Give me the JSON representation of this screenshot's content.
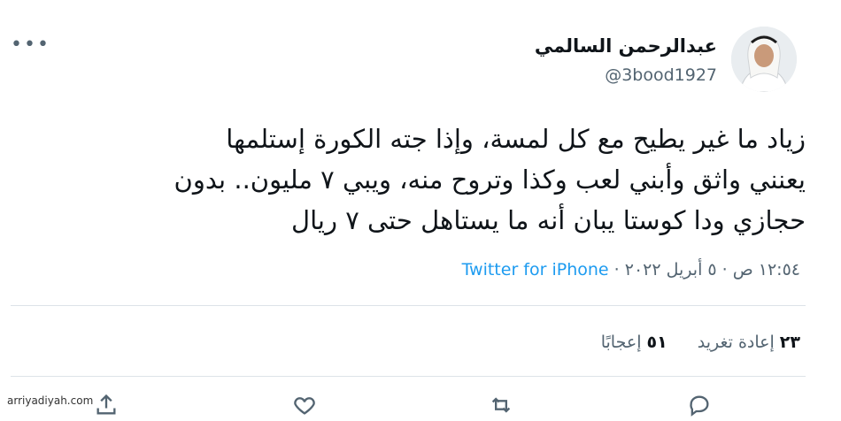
{
  "user": {
    "display_name": "عبدالرحمن السالمي",
    "handle": "@3bood1927"
  },
  "tweet": {
    "lines": [
      "زياد ما غير يطيح مع كل لمسة، وإذا جته الكورة إستلمها",
      "يعنني واثق وأبني لعب وكذا وتروح منه، ويبي ٧ مليون.. بدون",
      "حجازي ودا كوستا يبان أنه ما يستاهل حتى ٧ ريال"
    ],
    "time": "١٢:٥٤ ص",
    "date": "٥ أبريل ٢٠٢٢",
    "separator": "·",
    "source": "Twitter for iPhone"
  },
  "stats": {
    "retweets_count": "٢٣",
    "retweets_label": "إعادة تغريد",
    "likes_count": "٥١",
    "likes_label": "إعجابًا"
  },
  "icons": {
    "more": "more-horizontal-icon",
    "reply": "reply-icon",
    "retweet": "retweet-icon",
    "like": "heart-icon",
    "share": "share-icon"
  },
  "watermark": "arriyadiyah.com"
}
